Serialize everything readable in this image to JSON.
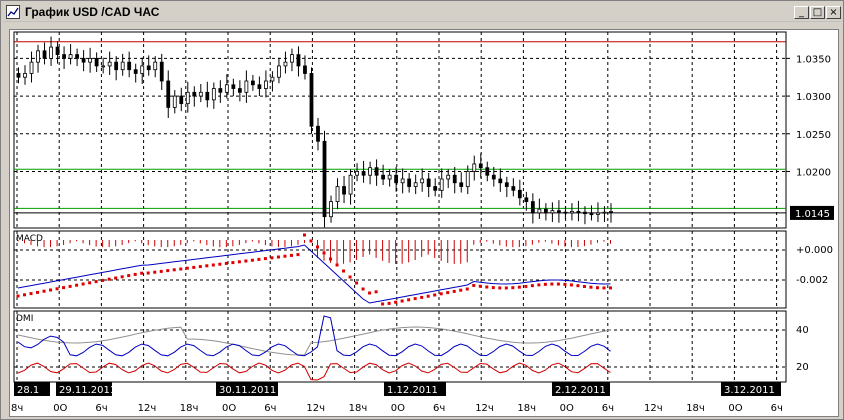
{
  "window": {
    "title": "График USD /CAD  ЧАС",
    "minimize_label": "_",
    "maximize_label": "□",
    "close_label": "×"
  },
  "price_axis": {
    "labels": [
      "1.0350",
      "1.0300",
      "1.0250",
      "1.0200"
    ],
    "current_price": "1.0145"
  },
  "macd_panel": {
    "name": "MACD",
    "labels": [
      "+0.000",
      "-0.002"
    ]
  },
  "dmi_panel": {
    "name": "DMI",
    "labels": [
      "40",
      "20"
    ]
  },
  "time_axis": {
    "date_labels": [
      "28.1",
      "29.11.2011",
      "30.11.2011",
      "1.12.2011",
      "2.12.2011",
      "3.12.2011"
    ],
    "hour_labels": [
      "8ч",
      "0О",
      "6ч",
      "12ч",
      "18ч",
      "0О",
      "6ч",
      "12ч",
      "18ч",
      "0О",
      "6ч",
      "12ч",
      "18ч",
      "0О",
      "6ч",
      "12ч",
      "18ч",
      "0О",
      "6ч"
    ]
  },
  "colors": {
    "resistance_line": "#c00000",
    "support_line": "#00a000",
    "macd_line": "#0000c0",
    "signal_dots": "#e00000",
    "dmi_plus": "#0000c0",
    "dmi_minus": "#d00000",
    "adx": "#909090"
  },
  "chart_data": {
    "type": "candlestick",
    "symbol": "USD /CAD",
    "timeframe": "ЧАС",
    "y_range": [
      1.0125,
      1.0385
    ],
    "horizontal_levels": [
      1.0372,
      1.0203,
      1.0151,
      1.0145
    ],
    "closes": [
      1.0325,
      1.033,
      1.0345,
      1.036,
      1.035,
      1.0365,
      1.0355,
      1.035,
      1.0355,
      1.035,
      1.0345,
      1.035,
      1.034,
      1.034,
      1.0345,
      1.0335,
      1.0345,
      1.0335,
      1.033,
      1.034,
      1.0335,
      1.0345,
      1.032,
      1.0285,
      1.03,
      1.029,
      1.0305,
      1.03,
      1.0305,
      1.0295,
      1.031,
      1.0305,
      1.0315,
      1.031,
      1.0305,
      1.032,
      1.0315,
      1.031,
      1.032,
      1.0325,
      1.034,
      1.0345,
      1.0355,
      1.034,
      1.033,
      1.026,
      1.024,
      1.014,
      1.016,
      1.018,
      1.017,
      1.0195,
      1.02,
      1.0195,
      1.0205,
      1.0195,
      1.019,
      1.0195,
      1.0185,
      1.019,
      1.018,
      1.0185,
      1.019,
      1.018,
      1.0175,
      1.019,
      1.0195,
      1.0185,
      1.018,
      1.02,
      1.021,
      1.0205,
      1.0195,
      1.019,
      1.0185,
      1.018,
      1.0175,
      1.0165,
      1.016,
      1.0145,
      1.015,
      1.0145,
      1.0148,
      1.0146,
      1.0145,
      1.0147,
      1.0146,
      1.0144,
      1.0143,
      1.0145,
      1.0146,
      1.0147
    ]
  }
}
